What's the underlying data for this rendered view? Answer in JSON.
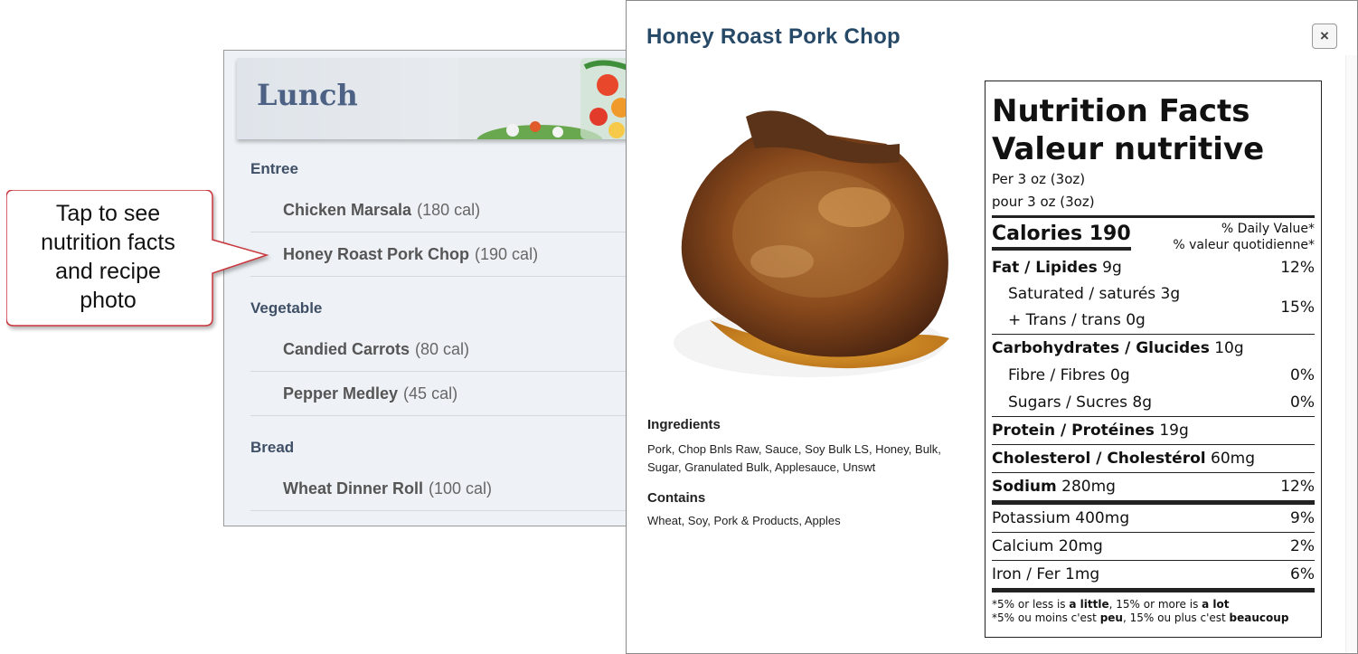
{
  "menu": {
    "title": "Lunch",
    "categories": [
      {
        "name": "Entree",
        "items": [
          {
            "name": "Chicken Marsala",
            "cal": "(180 cal)"
          },
          {
            "name": "Honey Roast Pork Chop",
            "cal": "(190 cal)"
          }
        ]
      },
      {
        "name": "Vegetable",
        "items": [
          {
            "name": "Candied Carrots",
            "cal": "(80 cal)"
          },
          {
            "name": "Pepper Medley",
            "cal": "(45 cal)"
          }
        ]
      },
      {
        "name": "Bread",
        "items": [
          {
            "name": "Wheat Dinner Roll",
            "cal": "(100 cal)"
          }
        ]
      }
    ]
  },
  "callout": {
    "line1": "Tap to see",
    "line2": "nutrition facts",
    "line3": "and recipe",
    "line4": "photo"
  },
  "modal": {
    "title": "Honey Roast Pork Chop",
    "close_label": "×",
    "ingredients_label": "Ingredients",
    "ingredients_text": "Pork, Chop Bnls Raw, Sauce, Soy Bulk LS, Honey, Bulk, Sugar, Granulated Bulk, Applesauce, Unswt",
    "contains_label": "Contains",
    "contains_text": "Wheat, Soy, Pork & Products, Apples"
  },
  "nutrition": {
    "title_en": "Nutrition Facts",
    "title_fr": "Valeur nutritive",
    "per_en": "Per 3 oz (3oz)",
    "per_fr": "pour 3 oz (3oz)",
    "calories": "Calories 190",
    "dv_en": "% Daily Value*",
    "dv_fr": "% valeur quotidienne*",
    "fat_label": "Fat / Lipides",
    "fat_amount": "9g",
    "fat_pct": "12%",
    "sat_label": "Saturated / saturés 3g",
    "trans_label": "+ Trans / trans 0g",
    "sat_trans_pct": "15%",
    "carb_label": "Carbohydrates / Glucides",
    "carb_amount": "10g",
    "fibre_label": "Fibre / Fibres 0g",
    "fibre_pct": "0%",
    "sugars_label": "Sugars / Sucres 8g",
    "sugars_pct": "0%",
    "protein_label": "Protein / Protéines",
    "protein_amount": "19g",
    "chol_label": "Cholesterol / Cholestérol",
    "chol_amount": "60mg",
    "sodium_label": "Sodium",
    "sodium_amount": "280mg",
    "sodium_pct": "12%",
    "potassium": "Potassium 400mg",
    "potassium_pct": "9%",
    "calcium": "Calcium 20mg",
    "calcium_pct": "2%",
    "iron": "Iron / Fer 1mg",
    "iron_pct": "6%",
    "foot_en_a": "*5% or less is ",
    "foot_en_b": "a little",
    "foot_en_c": ", 15% or more is ",
    "foot_en_d": "a lot",
    "foot_fr_a": "*5% ou moins c'est ",
    "foot_fr_b": "peu",
    "foot_fr_c": ", 15% ou plus c'est ",
    "foot_fr_d": "beaucoup"
  },
  "colors": {
    "menu_title": "#4c6183",
    "modal_title": "#274968",
    "callout_border": "#c8343a"
  },
  "icons": [
    "close-icon",
    "pork-chop-photo",
    "salad-jar-image",
    "callout-pointer"
  ]
}
